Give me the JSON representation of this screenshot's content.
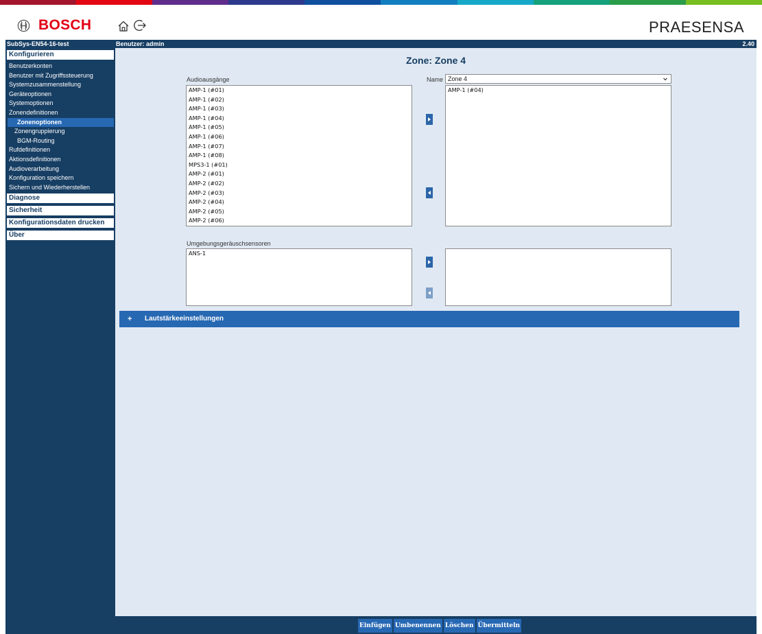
{
  "header": {
    "brand": "BOSCH",
    "product": "PRAESENSA",
    "stripe_colors": [
      "#a3152c",
      "#e30613",
      "#5f2e8c",
      "#2d3a8c",
      "#0f4f9e",
      "#137fc0",
      "#16a8c9",
      "#15a17c",
      "#2b9d4a",
      "#78be20"
    ]
  },
  "status": {
    "system": "SubSys-EN54-16-test",
    "user": "Benutzer: admin",
    "version": "2.40"
  },
  "sidebar": {
    "sections": [
      "Konfigurieren",
      "Diagnose",
      "Sicherheit",
      "Konfigurationsdaten drucken",
      "Über"
    ],
    "items": [
      "Benutzerkonten",
      "Benutzer mit Zugriffssteuerung",
      "Systemzusammenstellung",
      "Geräteoptionen",
      "Systemoptionen",
      "Zonendefinitionen",
      "Zonenoptionen",
      "Zonengruppierung",
      "BGM-Routing",
      "Rufdefinitionen",
      "Aktionsdefinitionen",
      "Audioverarbeitung",
      "Konfiguration speichern",
      "Sichern und Wiederherstellen"
    ]
  },
  "main": {
    "title": "Zone: Zone 4",
    "audio_caption": "Audioausgänge",
    "name_label": "Name",
    "name_value": "Zone 4",
    "audio_available": [
      "AMP-1 (#01)",
      "AMP-1 (#02)",
      "AMP-1 (#03)",
      "AMP-1 (#04)",
      "AMP-1 (#05)",
      "AMP-1 (#06)",
      "AMP-1 (#07)",
      "AMP-1 (#08)",
      "MPS3-1 (#01)",
      "AMP-2 (#01)",
      "AMP-2 (#02)",
      "AMP-2 (#03)",
      "AMP-2 (#04)",
      "AMP-2 (#05)",
      "AMP-2 (#06)"
    ],
    "audio_assigned": [
      "AMP-1 (#04)"
    ],
    "sensor_caption": "Umgebungsgeräuschsensoren",
    "sensor_available": [
      "ANS-1"
    ],
    "sensor_assigned": [],
    "volume_plus": "+",
    "volume_label": "Lautstärkeeinstellungen"
  },
  "footer": {
    "buttons": [
      "Einfügen",
      "Umbenennen",
      "Löschen",
      "Übermitteln"
    ]
  }
}
